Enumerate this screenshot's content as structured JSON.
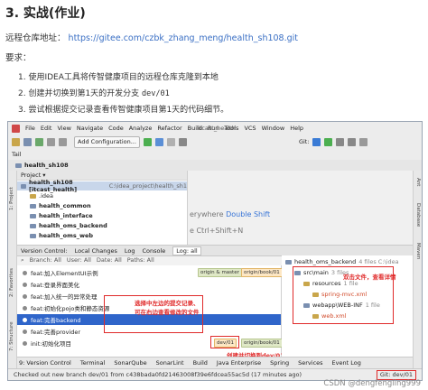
{
  "doc": {
    "title": "3. 实战(作业)",
    "repo_label": "远程仓库地址：",
    "repo_url": "https://gitee.com/czbk_zhang_meng/health_sh108.git",
    "requirements_label": "要求：",
    "steps": [
      {
        "text": "1. 使用IDEA工具将传智健康项目的远程仓库克隆到本地",
        "code": ""
      },
      {
        "text": "2. 创建并切换到第1天的开发分支 ",
        "code": "dev/01"
      },
      {
        "text": "3. 尝试根据提交记录查看传智健康项目第1天的代码细节。",
        "code": ""
      }
    ]
  },
  "ide": {
    "menu": [
      "File",
      "Edit",
      "View",
      "Navigate",
      "Code",
      "Analyze",
      "Refactor",
      "Build",
      "Run",
      "Tools",
      "VCS",
      "Window",
      "Help"
    ],
    "window_title": "itcast_health",
    "add_configuration": "Add Configuration...",
    "git_label": "Git:",
    "nav_path": "Tail",
    "breadcrumb": "health_sh108",
    "project_header": "Project ▾",
    "tree": [
      {
        "label": "health_sh108 [itcast_health]",
        "path": " C:\\idea_project\\health_sh1",
        "indent": 4,
        "selected": true
      },
      {
        "label": ".idea",
        "path": "",
        "indent": 14,
        "selected": false
      },
      {
        "label": "health_common",
        "path": "",
        "indent": 14,
        "selected": false
      },
      {
        "label": "health_interface",
        "path": "",
        "indent": 14,
        "selected": false
      },
      {
        "label": "health_oms_backend",
        "path": "",
        "indent": 14,
        "selected": false
      },
      {
        "label": "health_oms_web",
        "path": "",
        "indent": 14,
        "selected": false
      }
    ],
    "editor_hints": [
      {
        "text": "erywhere ",
        "key": "Double Shift"
      },
      {
        "text": "e Ctrl+Shift+N",
        "key": ""
      }
    ],
    "left_strip": [
      "1: Project",
      "2: Favorites",
      "7: Structure"
    ],
    "right_strip": [
      "Ant",
      "Database",
      "Maven"
    ],
    "vc_tabs": [
      "Version Control:",
      "Local Changes",
      "Log",
      "Console",
      "Log: all"
    ],
    "log_filters": [
      "Branch: All",
      "User: All",
      "Date: All",
      "Paths: All"
    ],
    "commits": [
      {
        "msg": "feat:加入ElementUI示例",
        "selected": false,
        "tags": []
      },
      {
        "msg": "feat:登录界面美化",
        "selected": false,
        "tags": []
      },
      {
        "msg": "feat:加入统一的异常处理",
        "selected": false,
        "tags": []
      },
      {
        "msg": "feat:初始化pojo类和静态资源",
        "selected": false,
        "tags": []
      },
      {
        "msg": "feat:完善backend",
        "selected": true,
        "tags": []
      },
      {
        "msg": "feat:完善provider",
        "selected": false,
        "tags": []
      },
      {
        "msg": "init:初始化项目",
        "selected": false,
        "tags": [
          "dev/01",
          "origin/book/01"
        ]
      }
    ],
    "top_tags": [
      "origin & master",
      "origin/book/01"
    ],
    "files_root": "health_oms_backend",
    "files_root_meta": "4 files C:\\idea",
    "files": [
      {
        "label": "src\\main",
        "meta": "3 files",
        "xml": false
      },
      {
        "label": "resources",
        "meta": "1 file",
        "xml": false
      },
      {
        "label": "spring-mvc.xml",
        "meta": "",
        "xml": true
      },
      {
        "label": "webapp\\WEB-INF",
        "meta": "1 file",
        "xml": false
      },
      {
        "label": "web.xml",
        "meta": "",
        "xml": true
      }
    ],
    "annotations": {
      "files": "双击文件，查看详情",
      "commits_line1": "选择中左边的提交记录、",
      "commits_line2": "可在右边查看修改的文件",
      "branch": "创建并切换到dev/01"
    },
    "bottom_tabs": [
      "9: Version Control",
      "Terminal",
      "SonarQube",
      "SonarLint",
      "Build",
      "Java Enterprise",
      "Spring",
      "Services",
      "Event Log"
    ],
    "status_text": "Checked out new branch dev/01 from c438bada0fd21463008f39e6fdcea55ac5d (17 minutes ago)",
    "git_status": "Git: dev/01"
  },
  "watermark": "CSDN @dengfengling999",
  "colors": {
    "accent": "#2f65ca",
    "annotation": "#e02a2a",
    "link": "#3a6fc4"
  }
}
